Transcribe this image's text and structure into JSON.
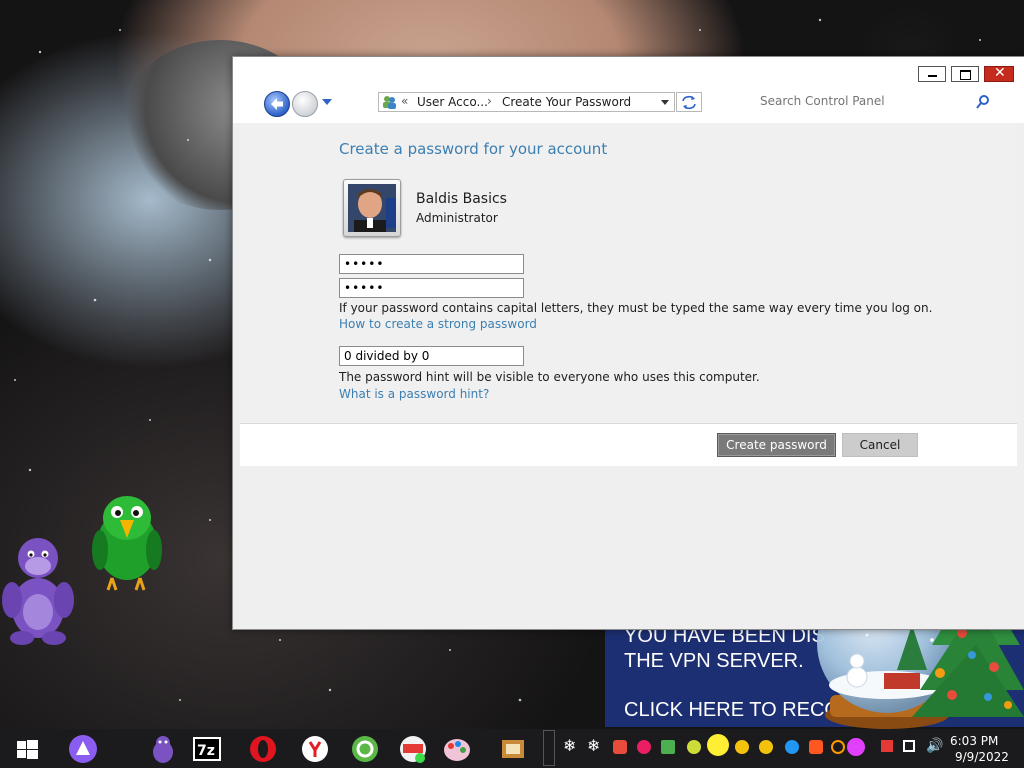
{
  "window": {
    "minimize_label": "minimize",
    "maximize_label": "maximize",
    "close_label": "close"
  },
  "address": {
    "separator": "«",
    "crumb1": "User Acco...",
    "arrow": "›",
    "crumb2": "Create Your Password"
  },
  "search": {
    "placeholder": "Search Control Panel"
  },
  "content": {
    "title": "Create a password for your account",
    "account_name": "Baldis Basics",
    "account_role": "Administrator",
    "password_value": "•••••",
    "confirm_value": "•••••",
    "caps_note": "If your password contains capital letters, they must be typed the same way every time you log on.",
    "strong_link": "How to create a strong password",
    "hint_value": "0 divided by 0",
    "hint_note": "The password hint will be visible to everyone who uses this computer.",
    "hint_link": "What is a password hint?"
  },
  "buttons": {
    "create": "Create password",
    "cancel": "Cancel"
  },
  "vpn_banner": {
    "line1": "YOU HAVE BEEN DIS",
    "line2": "THE VPN SERVER.",
    "line3": "CLICK HERE TO RECO"
  },
  "taskbar": {
    "time": "6:03 PM",
    "date": "9/9/2022",
    "app_icons": [
      "windows-start-icon",
      "alice-assistant-icon",
      "bonzibuddy-icon",
      "7zip-icon",
      "opera-icon",
      "yandex-icon",
      "ccleaner-icon",
      "fast-video-icon",
      "paint-icon",
      "archive-icon"
    ]
  },
  "colors": {
    "link_blue": "#3c7fb1",
    "vpn_blue": "#1c2f72",
    "close_red": "#c42b1c"
  }
}
